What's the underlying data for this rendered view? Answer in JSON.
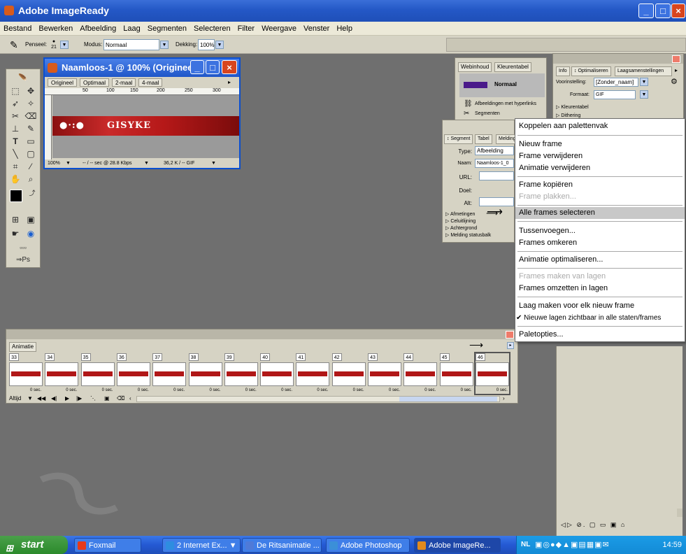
{
  "app": {
    "title": "Adobe ImageReady"
  },
  "menubar": [
    "Bestand",
    "Bewerken",
    "Afbeelding",
    "Laag",
    "Segmenten",
    "Selecteren",
    "Filter",
    "Weergave",
    "Venster",
    "Help"
  ],
  "options": {
    "brush_label": "Penseel:",
    "brush_size": "21",
    "mode_label": "Modus:",
    "mode_value": "Normaal",
    "opacity_label": "Dekking:",
    "opacity_value": "100%"
  },
  "document": {
    "title": "Naamloos-1 @ 100% (Origineel)",
    "tabs": [
      "Origineel",
      "Optimaal",
      "2-maal",
      "4-maal"
    ],
    "ruler_ticks": [
      "50",
      "100",
      "150",
      "200",
      "250",
      "300"
    ],
    "banner_text": "GISYKE",
    "status_zoom": "100%",
    "status_speed": "-- / -- sec @ 28.8 Kbps",
    "status_size": "36,2 K / -- GIF"
  },
  "web_panel": {
    "tabs": [
      "Webinhoud",
      "Kleurentabel"
    ],
    "state_label": "Normaal",
    "row_links": "Afbeeldingen met hyperlinks",
    "row_segments": "Segmenten"
  },
  "segment_panel": {
    "tabs": [
      "Segment",
      "Tabel",
      "Melding"
    ],
    "type_label": "Type:",
    "type_value": "Afbeelding",
    "name_label": "Naam:",
    "name_value": "Naamloos-1_0",
    "url_label": "URL:",
    "target_label": "Doel:",
    "alt_label": "Alt:",
    "sections": [
      "Afmetingen",
      "Celuitlijning",
      "Achtergrond",
      "Melding statusbalk"
    ]
  },
  "info_panel": {
    "tabs": [
      "Info",
      "Optimaliseren",
      "Laagsamenstellingen"
    ],
    "preset_label": "Voorinstelling:",
    "preset_value": "[Zonder_naam]",
    "format_label": "Formaat:",
    "format_value": "GIF",
    "sections": [
      "Kleurentabel",
      "Dithering"
    ]
  },
  "context_menu": {
    "items": [
      {
        "label": "Koppelen aan palettenvak",
        "state": "normal"
      },
      {
        "label": "Nieuw frame",
        "state": "normal"
      },
      {
        "label": "Frame verwijderen",
        "state": "normal"
      },
      {
        "label": "Animatie verwijderen",
        "state": "normal"
      },
      {
        "label": "Frame kopiëren",
        "state": "normal"
      },
      {
        "label": "Frame plakken...",
        "state": "disabled"
      },
      {
        "label": "Alle frames selecteren",
        "state": "highlighted"
      },
      {
        "label": "Tussenvoegen...",
        "state": "normal"
      },
      {
        "label": "Frames omkeren",
        "state": "normal"
      },
      {
        "label": "Animatie optimaliseren...",
        "state": "normal"
      },
      {
        "label": "Frames maken van lagen",
        "state": "disabled"
      },
      {
        "label": "Frames omzetten in lagen",
        "state": "normal"
      },
      {
        "label": "Laag maken voor elk nieuw frame",
        "state": "normal"
      },
      {
        "label": "Nieuwe lagen zichtbaar in alle staten/frames",
        "state": "checked"
      },
      {
        "label": "Paletopties...",
        "state": "normal"
      }
    ]
  },
  "animation": {
    "tab_label": "Animatie",
    "frames": [
      "33",
      "34",
      "35",
      "36",
      "37",
      "38",
      "39",
      "40",
      "41",
      "42",
      "43",
      "44",
      "45",
      "46"
    ],
    "delay_label": "0 sec.",
    "loop_value": "Altijd"
  },
  "taskbar": {
    "start_label": "start",
    "buttons": [
      "Foxmail",
      "2 Internet Ex...",
      "De Ritsanimatie ...",
      "Adobe Photoshop",
      "Adobe ImageRe..."
    ],
    "tray_lang": "NL",
    "clock": "14:59"
  },
  "colors": {
    "title_blue": "#2458c6",
    "taskbar_blue": "#2459d3",
    "banner_red": "#b51818",
    "workspace": "#6f6f6f"
  }
}
